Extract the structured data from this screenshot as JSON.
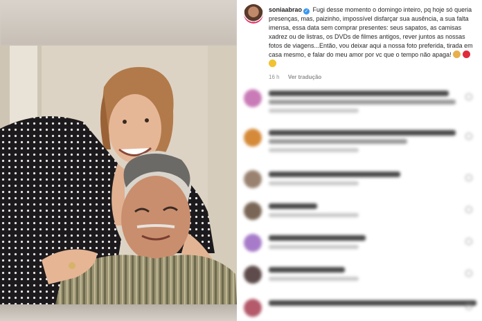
{
  "post": {
    "username": "soniaabrao",
    "caption": "Fugi desse momento o domingo inteiro, pq hoje só queria presenças, mas, paizinho, impossível disfarçar sua ausência, a sua falta imensa, essa data sem comprar presentes: seus sapatos, as camisas xadrez ou de listras, os DVDs de filmes antigos, rever juntos as nossas fotos de viagens...Então, vou deixar aqui a nossa foto preferida, tirada em casa mesmo, e falar do meu amor por vc que o tempo não apaga!",
    "caption_emojis": [
      "pray-emoji",
      "red-heart-emoji",
      "smile-emoji"
    ],
    "time_ago": "16 h",
    "translate_label": "Ver tradução"
  },
  "comments": [
    {
      "avatar_color": "#c97bb8"
    },
    {
      "avatar_color": "#d58a3a"
    },
    {
      "avatar_color": "#9a8270"
    },
    {
      "avatar_color": "#7a6656"
    },
    {
      "avatar_color": "#a77bc9"
    },
    {
      "avatar_color": "#5e4b4b"
    },
    {
      "avatar_color": "#b45a6a"
    }
  ],
  "colors": {
    "verified": "#3897f0",
    "meta_text": "#8e8e8e",
    "story_ring": "#e1306c"
  }
}
